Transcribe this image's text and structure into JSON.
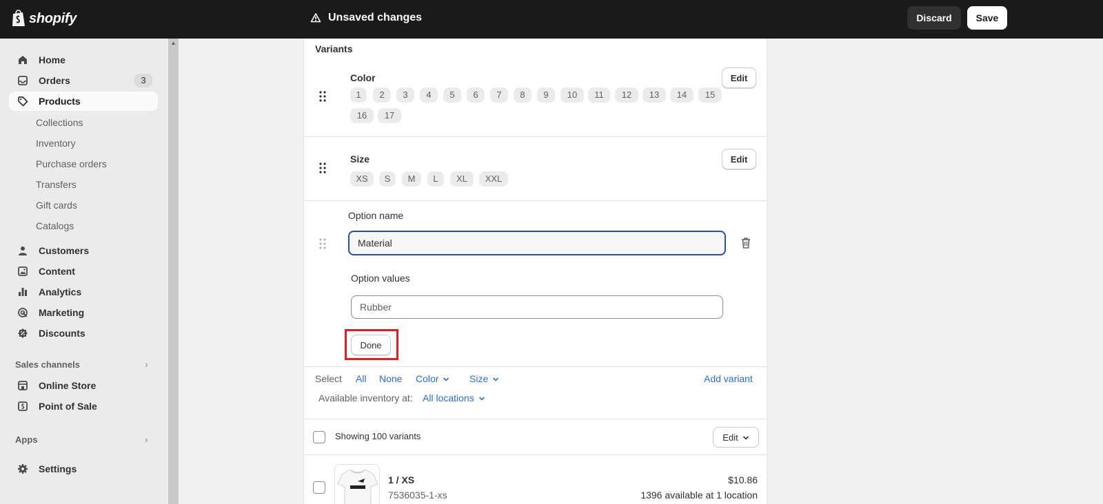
{
  "topbar": {
    "logo_text": "shopify",
    "status": "Unsaved changes",
    "discard_label": "Discard",
    "save_label": "Save"
  },
  "sidebar": {
    "items": [
      {
        "label": "Home",
        "icon": "home-icon"
      },
      {
        "label": "Orders",
        "icon": "inbox-icon",
        "badge": "3"
      },
      {
        "label": "Products",
        "icon": "tag-icon",
        "active": true
      }
    ],
    "product_subitems": [
      "Collections",
      "Inventory",
      "Purchase orders",
      "Transfers",
      "Gift cards",
      "Catalogs"
    ],
    "items2": [
      {
        "label": "Customers",
        "icon": "person-icon"
      },
      {
        "label": "Content",
        "icon": "image-icon"
      },
      {
        "label": "Analytics",
        "icon": "bar-chart-icon"
      },
      {
        "label": "Marketing",
        "icon": "target-icon"
      },
      {
        "label": "Discounts",
        "icon": "discount-icon"
      }
    ],
    "sales_channels_label": "Sales channels",
    "channels": [
      {
        "label": "Online Store",
        "icon": "store-icon"
      },
      {
        "label": "Point of Sale",
        "icon": "pos-icon"
      }
    ],
    "apps_label": "Apps",
    "settings_label": "Settings"
  },
  "variants": {
    "title": "Variants",
    "options": [
      {
        "name": "Color",
        "values": [
          "1",
          "2",
          "3",
          "4",
          "5",
          "6",
          "7",
          "8",
          "9",
          "10",
          "11",
          "12",
          "13",
          "14",
          "15",
          "16",
          "17"
        ],
        "edit_label": "Edit"
      },
      {
        "name": "Size",
        "values": [
          "XS",
          "S",
          "M",
          "L",
          "XL",
          "XXL"
        ],
        "edit_label": "Edit"
      }
    ],
    "new_option": {
      "name_label": "Option name",
      "name_value": "Material",
      "values_label": "Option values",
      "values_placeholder": "Rubber",
      "done_label": "Done"
    },
    "select_bar": {
      "select_label": "Select",
      "all": "All",
      "none": "None",
      "color": "Color",
      "size": "Size",
      "add_variant": "Add variant",
      "inventory_label": "Available inventory at:",
      "inventory_value": "All locations"
    },
    "list_header": {
      "showing": "Showing 100 variants",
      "edit_label": "Edit"
    },
    "rows": [
      {
        "title": "1 / XS",
        "sku": "7536035-1-xs",
        "price": "$10.86",
        "availability": "1396 available at 1 location"
      }
    ]
  }
}
